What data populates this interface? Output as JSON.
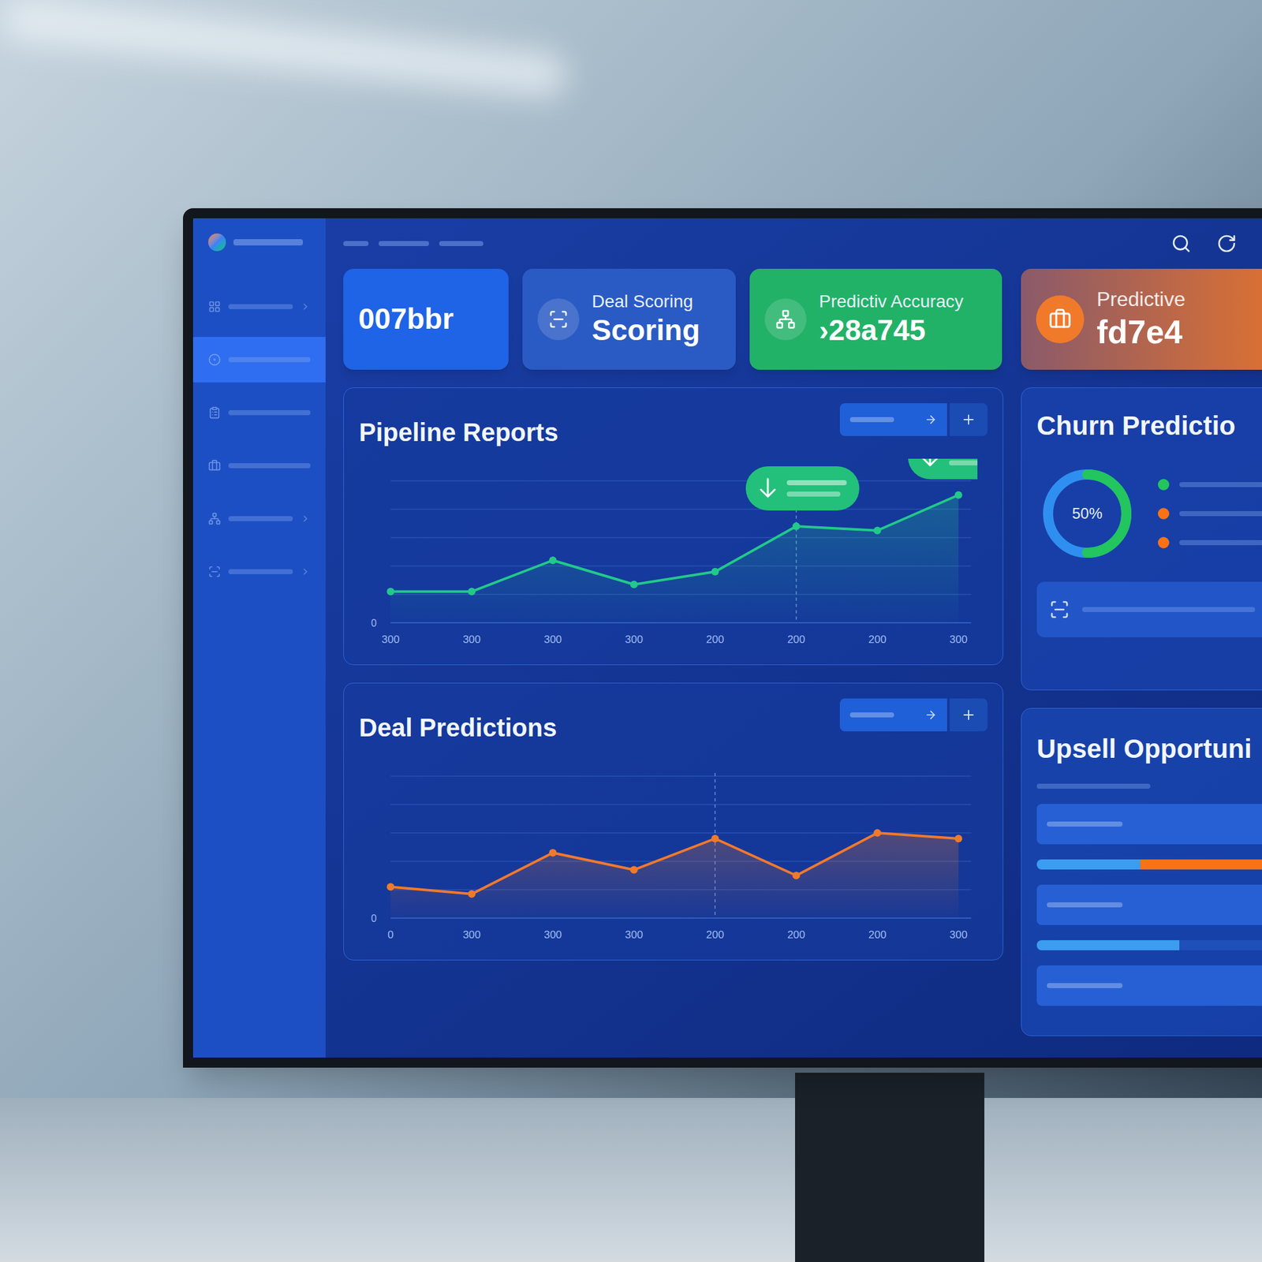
{
  "sidebar": {
    "items": [
      {
        "selected": false,
        "expandable": true
      },
      {
        "selected": true,
        "expandable": false
      },
      {
        "selected": false,
        "expandable": false
      },
      {
        "selected": false,
        "expandable": false
      },
      {
        "selected": false,
        "expandable": true
      },
      {
        "selected": false,
        "expandable": true
      }
    ]
  },
  "kpis": [
    {
      "label": "",
      "value": "007bbr",
      "color": "#1f63e6"
    },
    {
      "label": "Deal Scoring",
      "value": "Scoring",
      "color": "#2a5bc4"
    },
    {
      "label": "Predictiv Accuracy",
      "value": "›28a745",
      "color": "#22b267"
    },
    {
      "label": "Predictive",
      "value": "fd7e4",
      "color": "#e8742a"
    }
  ],
  "pipeline": {
    "title": "Pipeline Reports",
    "y_ticks": [
      "0"
    ],
    "x_ticks": [
      "300",
      "300",
      "300",
      "300",
      "200",
      "200",
      "200",
      "300"
    ],
    "values": [
      1.1,
      1.1,
      2.2,
      1.35,
      1.8,
      3.4,
      3.25,
      4.5
    ],
    "marker_point": 5,
    "annotations": [
      5,
      7
    ],
    "color": "#22c98a"
  },
  "deal_predictions": {
    "title": "Deal Predictions",
    "y_ticks": [
      "0"
    ],
    "x_ticks": [
      "0",
      "300",
      "300",
      "300",
      "200",
      "200",
      "200",
      "300"
    ],
    "values": [
      1.1,
      0.85,
      2.3,
      1.7,
      2.8,
      1.5,
      3.0,
      2.8
    ],
    "marker_point": 4,
    "color": "#f2792b"
  },
  "churn": {
    "title": "Churn Predictio",
    "reading": "50%",
    "level": 0.5,
    "legend": [
      {
        "color": "#22c55e"
      },
      {
        "color": "#f97316"
      },
      {
        "color": "#f97316"
      }
    ]
  },
  "upsell": {
    "title": "Upsell Opportuni",
    "bars": [
      {
        "segments": [
          {
            "level": 0.4,
            "color": "#3b9cf0"
          },
          {
            "level": 0.6,
            "color": "#f97316"
          }
        ]
      },
      {
        "segments": [
          {
            "level": 0.55,
            "color": "#3b9cf0"
          }
        ]
      }
    ]
  }
}
